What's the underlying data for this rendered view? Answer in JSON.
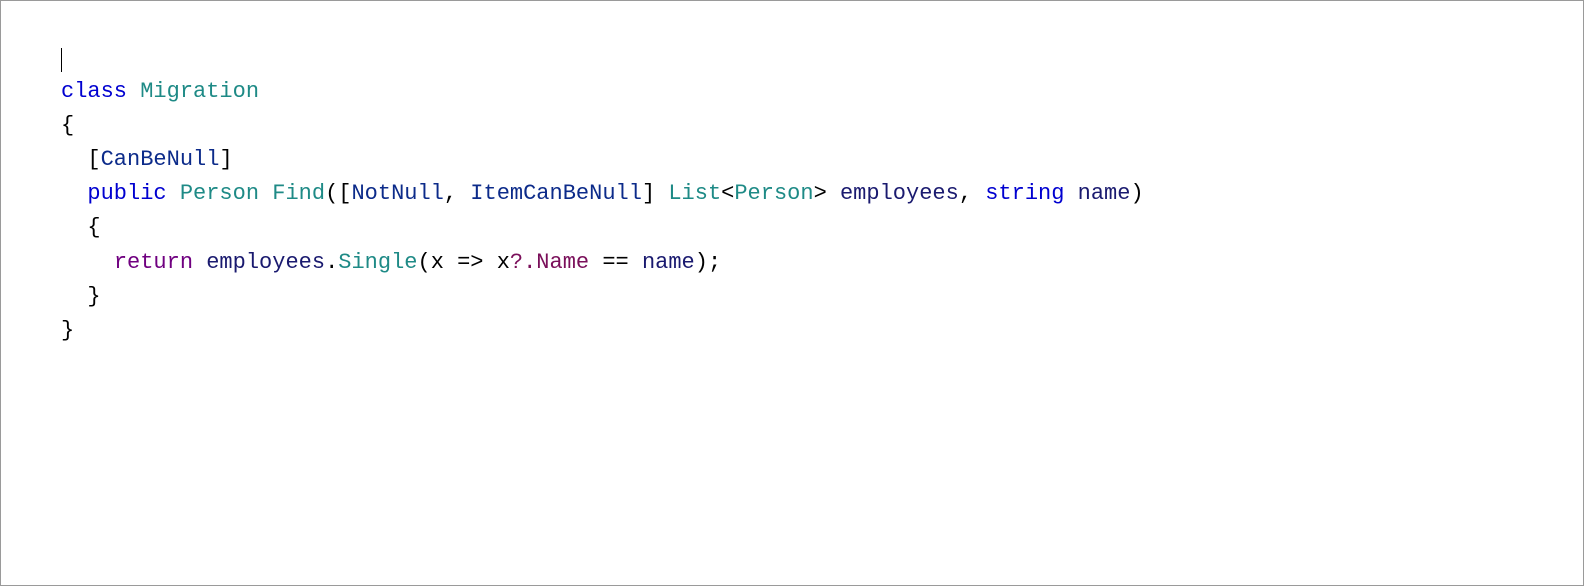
{
  "code": {
    "lines": [
      {
        "indent": 0,
        "tokens": [
          {
            "text": "",
            "cls": "",
            "cursor": true
          }
        ]
      },
      {
        "indent": 0,
        "tokens": [
          {
            "text": "class",
            "cls": "kw"
          },
          {
            "text": " ",
            "cls": ""
          },
          {
            "text": "Migration",
            "cls": "type"
          }
        ]
      },
      {
        "indent": 0,
        "tokens": [
          {
            "text": "{",
            "cls": "punct"
          }
        ]
      },
      {
        "indent": 1,
        "tokens": [
          {
            "text": "[",
            "cls": "punct"
          },
          {
            "text": "CanBeNull",
            "cls": "attr"
          },
          {
            "text": "]",
            "cls": "punct"
          }
        ]
      },
      {
        "indent": 1,
        "tokens": [
          {
            "text": "public",
            "cls": "kw"
          },
          {
            "text": " ",
            "cls": ""
          },
          {
            "text": "Person",
            "cls": "type"
          },
          {
            "text": " ",
            "cls": ""
          },
          {
            "text": "Find",
            "cls": "type"
          },
          {
            "text": "([",
            "cls": "punct"
          },
          {
            "text": "NotNull",
            "cls": "attr"
          },
          {
            "text": ", ",
            "cls": "punct"
          },
          {
            "text": "ItemCanBeNull",
            "cls": "attr"
          },
          {
            "text": "] ",
            "cls": "punct"
          },
          {
            "text": "List",
            "cls": "type"
          },
          {
            "text": "<",
            "cls": "punct"
          },
          {
            "text": "Person",
            "cls": "type"
          },
          {
            "text": "> ",
            "cls": "punct"
          },
          {
            "text": "employees",
            "cls": "param"
          },
          {
            "text": ", ",
            "cls": "punct"
          },
          {
            "text": "string",
            "cls": "kw"
          },
          {
            "text": " ",
            "cls": ""
          },
          {
            "text": "name",
            "cls": "param"
          },
          {
            "text": ")",
            "cls": "punct"
          }
        ]
      },
      {
        "indent": 1,
        "tokens": [
          {
            "text": "{",
            "cls": "punct"
          }
        ]
      },
      {
        "indent": 2,
        "tokens": [
          {
            "text": "return",
            "cls": "ret"
          },
          {
            "text": " ",
            "cls": ""
          },
          {
            "text": "employees",
            "cls": "param"
          },
          {
            "text": ".",
            "cls": "punct"
          },
          {
            "text": "Single",
            "cls": "type"
          },
          {
            "text": "(",
            "cls": "punct"
          },
          {
            "text": "x",
            "cls": "lambdaVar"
          },
          {
            "text": " => ",
            "cls": "punct"
          },
          {
            "text": "x",
            "cls": "lambdaVar"
          },
          {
            "text": "?.Name",
            "cls": "member"
          },
          {
            "text": " == ",
            "cls": "punct"
          },
          {
            "text": "name",
            "cls": "param"
          },
          {
            "text": ");",
            "cls": "punct"
          }
        ]
      },
      {
        "indent": 1,
        "tokens": [
          {
            "text": "}",
            "cls": "punct"
          }
        ]
      },
      {
        "indent": 0,
        "tokens": [
          {
            "text": "}",
            "cls": "punct"
          }
        ]
      }
    ],
    "indent_unit": "  "
  }
}
